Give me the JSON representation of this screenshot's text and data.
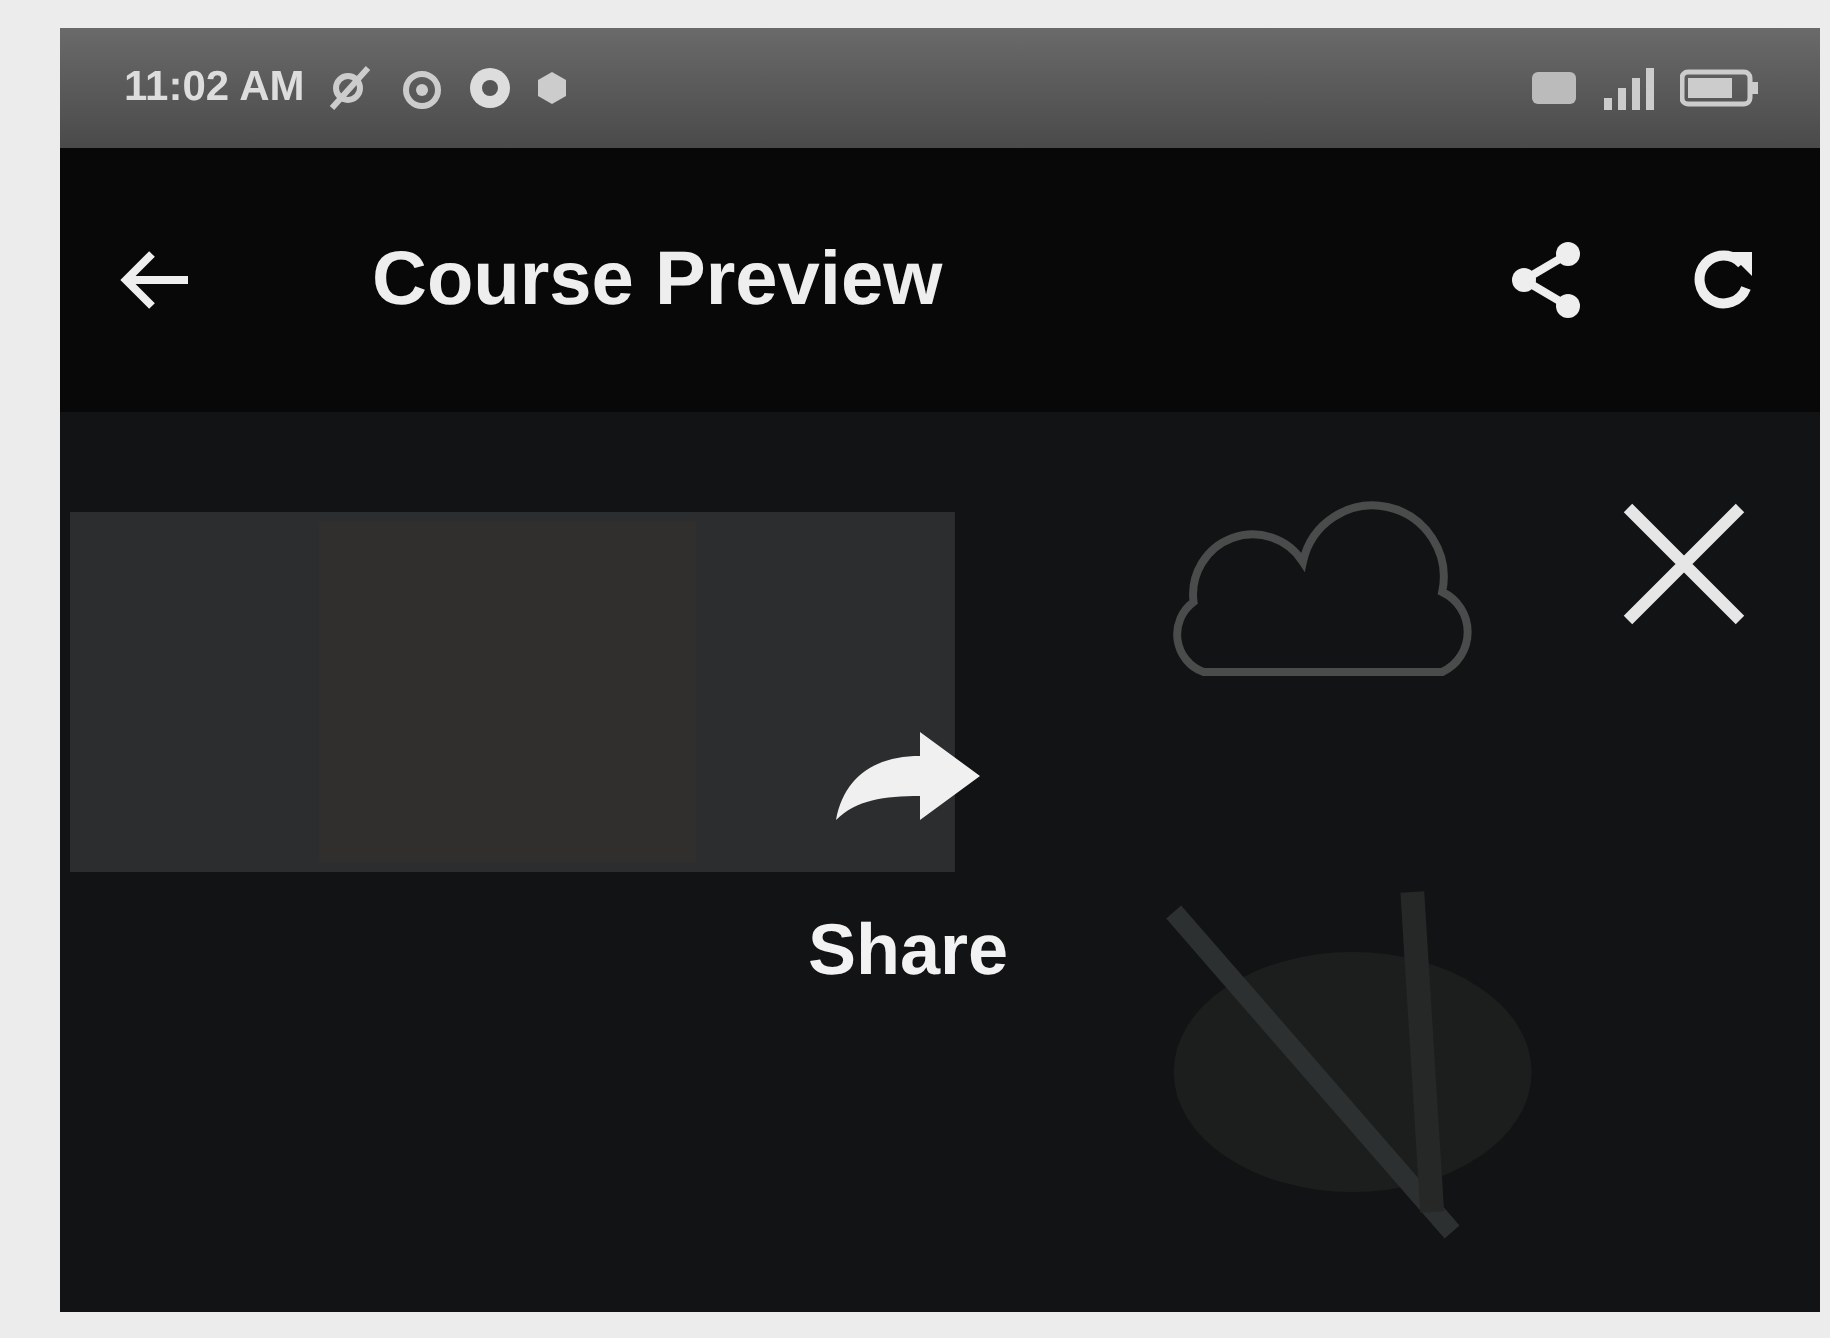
{
  "status_bar": {
    "time": "11:02 AM"
  },
  "app_bar": {
    "title": "Course Preview"
  },
  "video": {
    "kind": "picture",
    "share_label": "Share"
  }
}
